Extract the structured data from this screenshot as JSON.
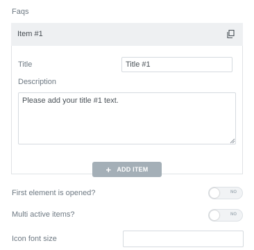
{
  "section": {
    "label": "Faqs"
  },
  "repeater": {
    "item": {
      "title": "Item #1",
      "copy_icon": "copy-icon",
      "fields": {
        "title_label": "Title",
        "title_value": "Title #1",
        "description_label": "Description",
        "description_value": "Please add your title #1 text."
      }
    },
    "add_item": {
      "icon": "plus-icon",
      "label": "ADD ITEM"
    }
  },
  "controls": {
    "first_opened": {
      "label": "First element is opened?",
      "state": "NO"
    },
    "multi_active": {
      "label": "Multi active items?",
      "state": "NO"
    },
    "icon_font_size": {
      "label": "Icon font size",
      "value": ""
    }
  },
  "colors": {
    "label_text": "#6d7882",
    "header_bg": "#eef0f2",
    "button_bg": "#a4afb7",
    "border": "#d5dadf"
  }
}
